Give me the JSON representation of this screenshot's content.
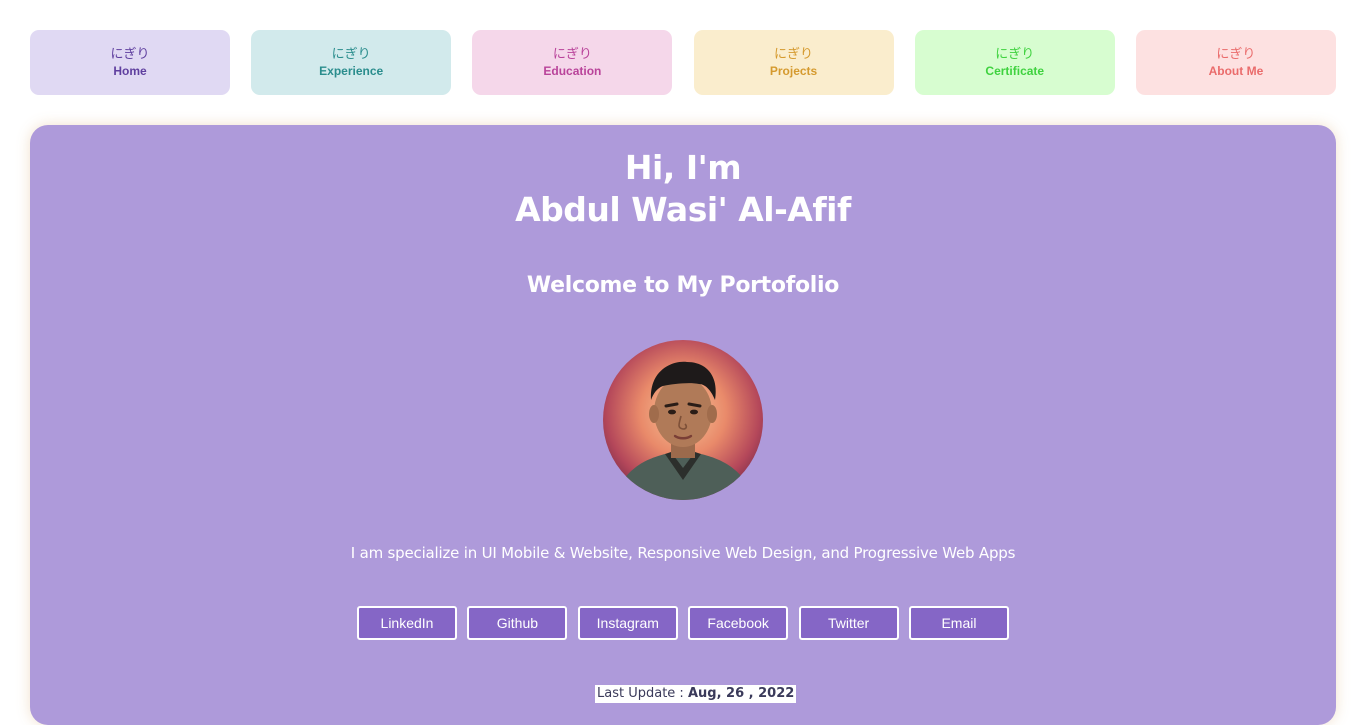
{
  "nav": {
    "items": [
      {
        "jp": "にぎり",
        "label": "Home",
        "bg": "#e0d9f3",
        "color": "#5f3f9f"
      },
      {
        "jp": "にぎり",
        "label": "Experience",
        "bg": "#d2eaec",
        "color": "#2a8d8d"
      },
      {
        "jp": "にぎり",
        "label": "Education",
        "bg": "#f5d7ea",
        "color": "#b9439a"
      },
      {
        "jp": "にぎり",
        "label": "Projects",
        "bg": "#faedcd",
        "color": "#d59a2e"
      },
      {
        "jp": "にぎり",
        "label": "Certificate",
        "bg": "#d7fdd0",
        "color": "#3fd23f"
      },
      {
        "jp": "にぎり",
        "label": "About Me",
        "bg": "#fde1e1",
        "color": "#ea6b6b"
      }
    ]
  },
  "hero": {
    "greeting": "Hi, I'm",
    "name": "Abdul Wasi' Al-Afif",
    "welcome": "Welcome to My Portofolio",
    "tagline": "I am specialize in UI Mobile & Website, Responsive Web Design, and Progressive Web Apps",
    "bg_color": "#ae9ada"
  },
  "socials": {
    "button_color": "#8566c6",
    "buttons": [
      "LinkedIn",
      "Github",
      "Instagram",
      "Facebook",
      "Twitter",
      "Email"
    ]
  },
  "footer": {
    "last_update_label": "Last Update :",
    "last_update_date": "Aug, 26 , 2022"
  }
}
